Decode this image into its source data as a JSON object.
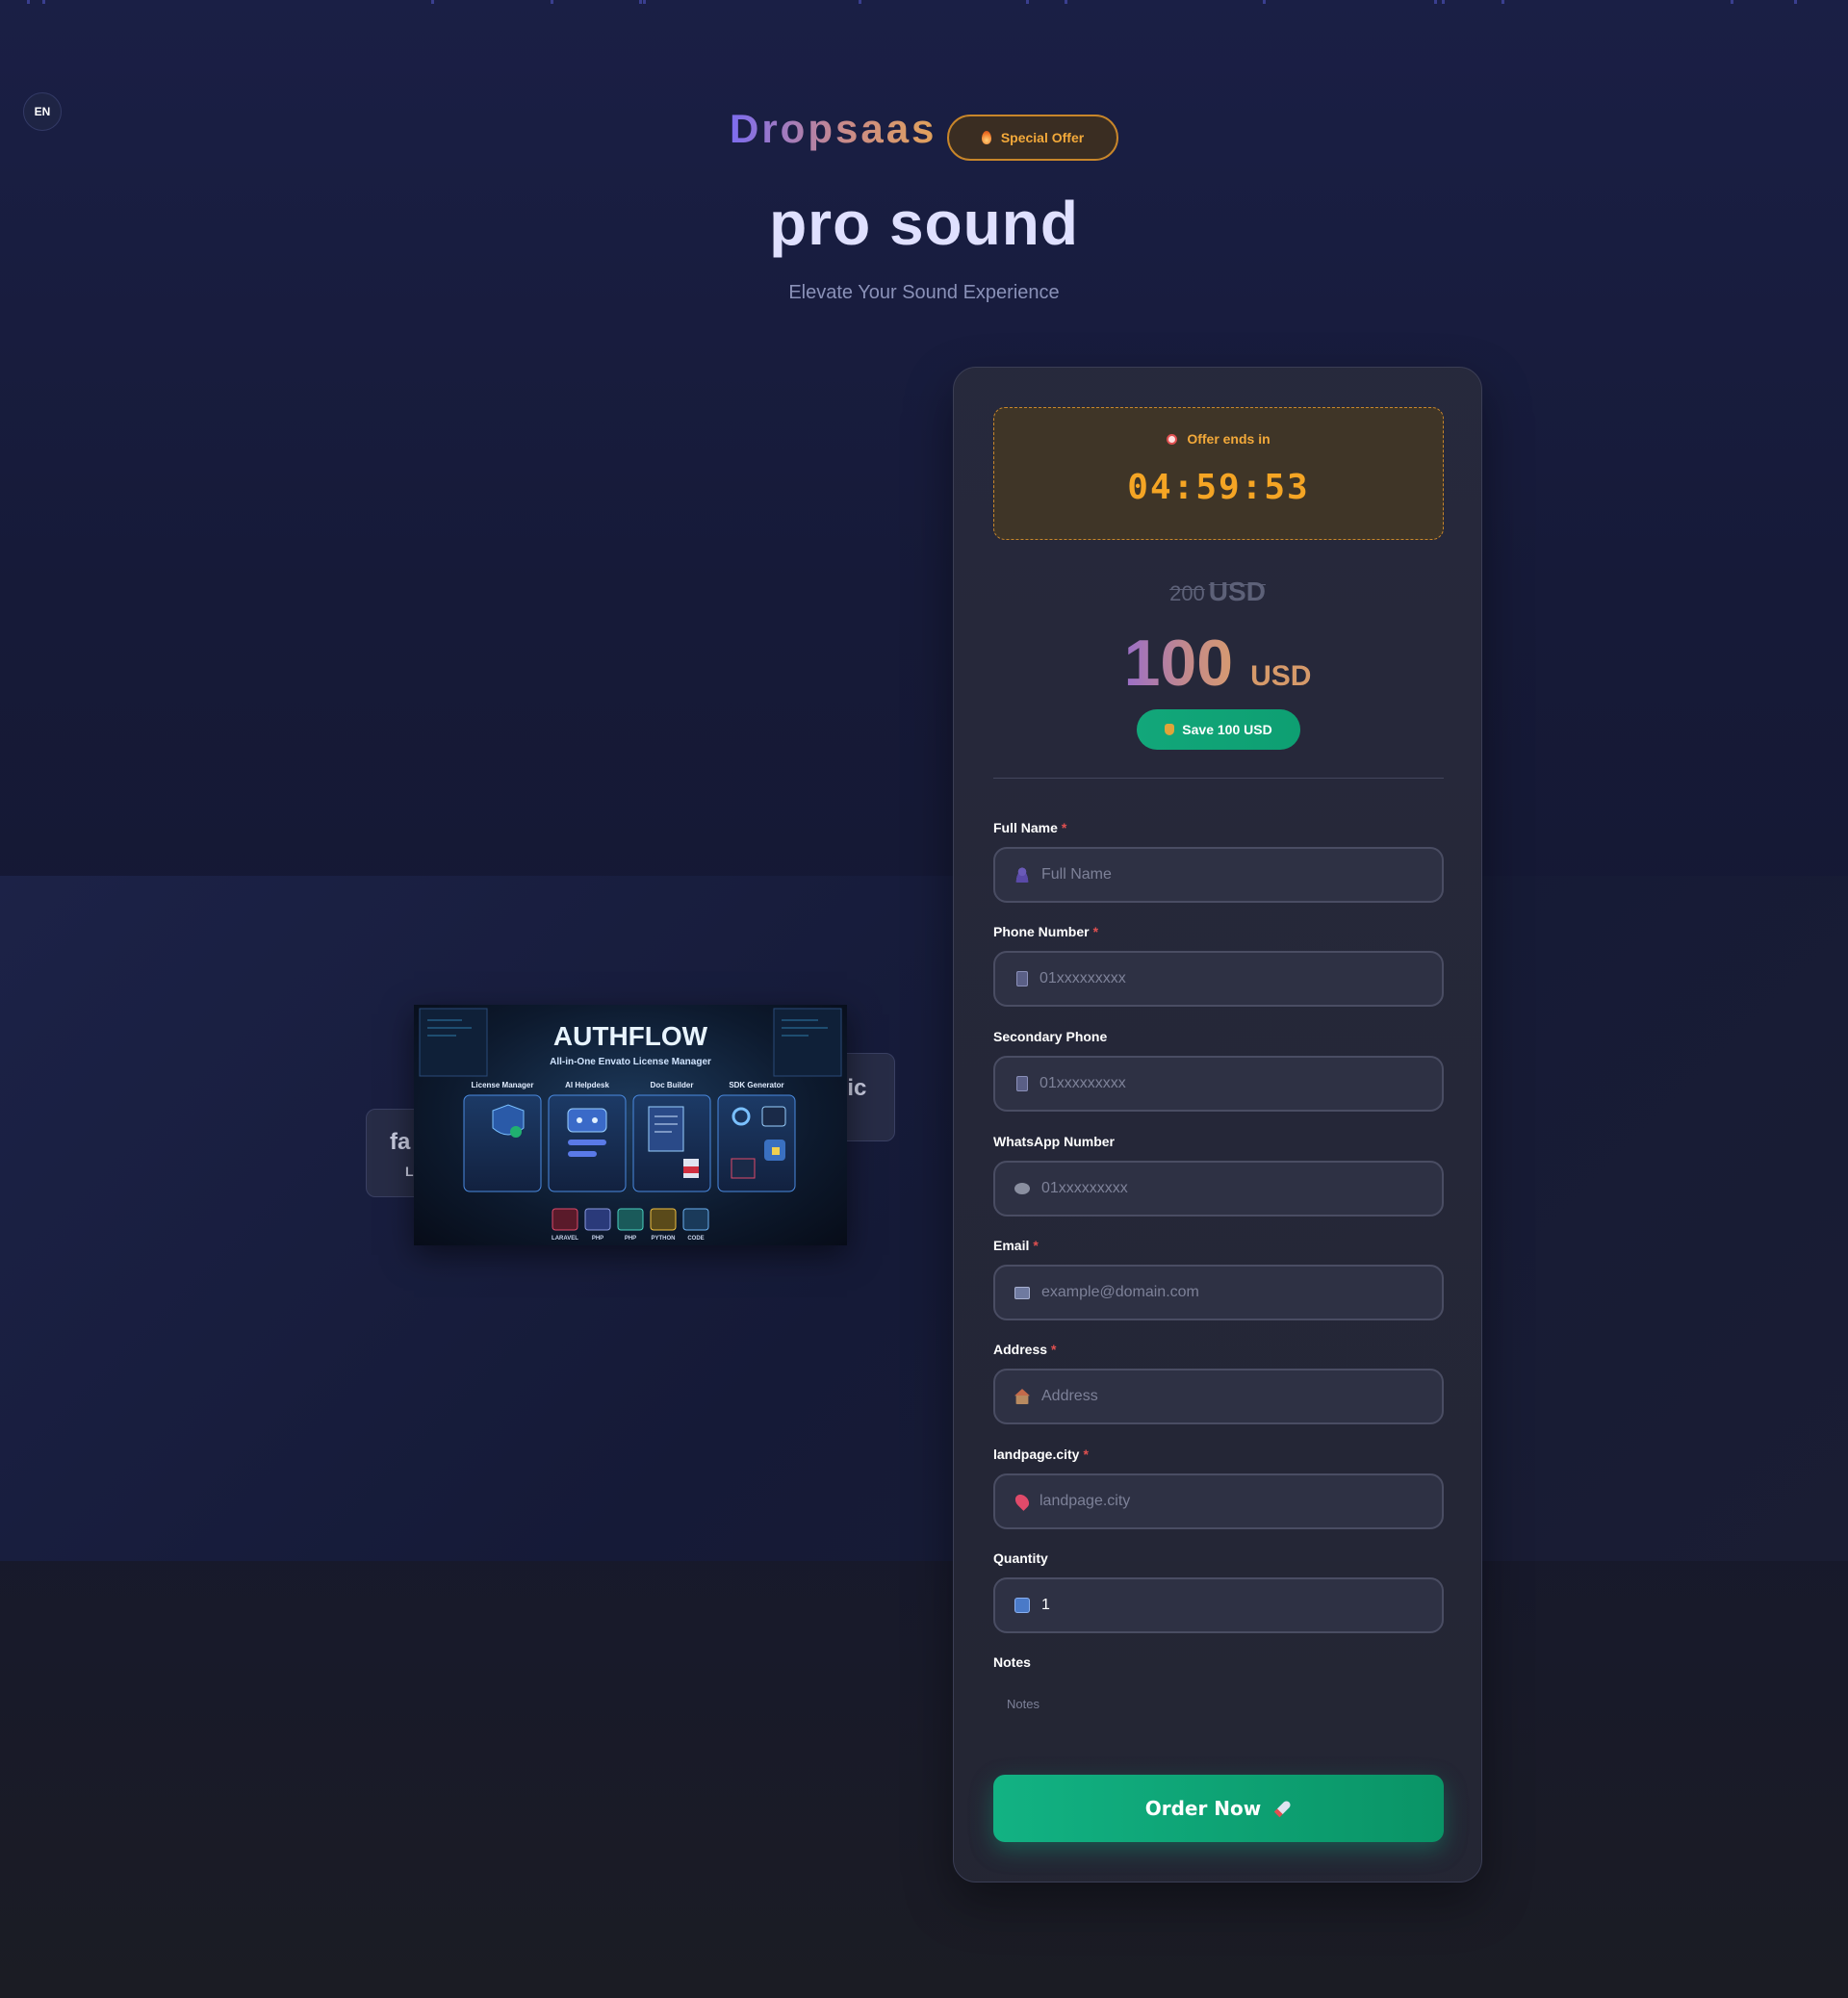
{
  "language": {
    "code": "EN"
  },
  "header": {
    "brand": "Dropsaas",
    "offer_badge": "Special Offer",
    "product_title": "pro sound",
    "product_subtitle": "Elevate Your Sound Experience"
  },
  "gallery": {
    "left_card_text": "fa",
    "left_card_sub": "L",
    "right_card_text": "sic",
    "main_image": {
      "title": "AUTHFLOW",
      "subtitle": "All-in-One Envato License Manager",
      "features": [
        "License Manager",
        "AI Helpdesk",
        "Doc Builder",
        "SDK Generator"
      ],
      "tech": [
        "LARAVEL",
        "PHP",
        "PHP",
        "PYTHON",
        "CODE"
      ]
    }
  },
  "offer": {
    "countdown_label": "Offer ends in",
    "countdown_time": "04:59:53",
    "old_price": "200",
    "old_currency": "USD",
    "price": "100",
    "currency": "USD",
    "save_label": "Save 100 USD"
  },
  "form": {
    "full_name": {
      "label": "Full Name",
      "required": "*",
      "placeholder": "Full Name",
      "value": ""
    },
    "phone": {
      "label": "Phone Number",
      "required": "*",
      "placeholder": "01xxxxxxxxx",
      "value": ""
    },
    "secondary_phone": {
      "label": "Secondary Phone",
      "placeholder": "01xxxxxxxxx",
      "value": ""
    },
    "whatsapp": {
      "label": "WhatsApp Number",
      "placeholder": "01xxxxxxxxx",
      "value": ""
    },
    "email": {
      "label": "Email",
      "required": "*",
      "placeholder": "example@domain.com",
      "value": ""
    },
    "address": {
      "label": "Address",
      "required": "*",
      "placeholder": "Address",
      "value": ""
    },
    "city": {
      "label": "landpage.city",
      "required": "*",
      "placeholder": "landpage.city",
      "value": ""
    },
    "quantity": {
      "label": "Quantity",
      "value": "1"
    },
    "notes": {
      "label": "Notes",
      "placeholder": "Notes"
    },
    "submit_label": "Order Now"
  },
  "colors": {
    "accent_green": "#12b283",
    "accent_orange": "#f5a524",
    "required_red": "#e05050"
  }
}
